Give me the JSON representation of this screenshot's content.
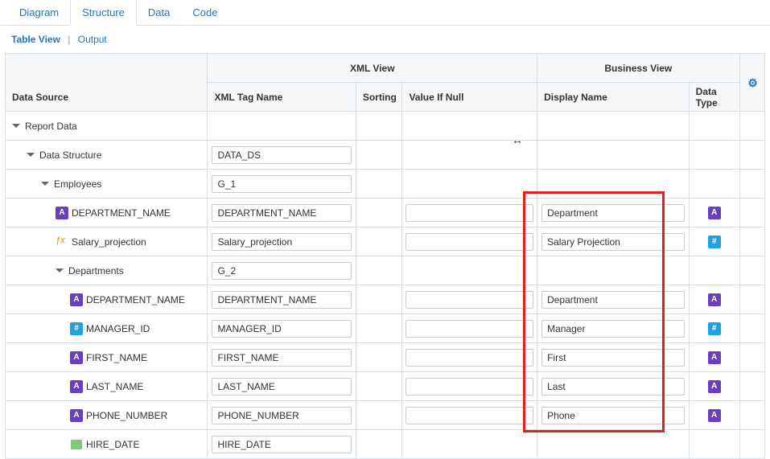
{
  "tabs": {
    "diagram": "Diagram",
    "structure": "Structure",
    "data": "Data",
    "code": "Code"
  },
  "subtabs": {
    "tableview": "Table View",
    "output": "Output"
  },
  "headers": {
    "xml_view": "XML View",
    "business_view": "Business View",
    "data_source": "Data Source",
    "xml_tag_name": "XML Tag Name",
    "sorting": "Sorting",
    "value_if_null": "Value If Null",
    "display_name": "Display Name",
    "data_type": "Data Type"
  },
  "rows": [
    {
      "indent": 1,
      "kind": "group",
      "label": "Report Data",
      "xml": "",
      "disp": "",
      "dtype": ""
    },
    {
      "indent": 2,
      "kind": "group",
      "label": "Data Structure",
      "xml": "DATA_DS",
      "disp": "",
      "dtype": ""
    },
    {
      "indent": 3,
      "kind": "group",
      "label": "Employees",
      "xml": "G_1",
      "disp": "",
      "dtype": ""
    },
    {
      "indent": 4,
      "kind": "field",
      "icon": "A",
      "label": "DEPARTMENT_NAME",
      "xml": "DEPARTMENT_NAME",
      "null": "",
      "disp": "Department",
      "dtype": "A"
    },
    {
      "indent": 4,
      "kind": "fx",
      "icon": "fx",
      "label": "Salary_projection",
      "xml": "Salary_projection",
      "null": "",
      "disp": "Salary Projection",
      "dtype": "H"
    },
    {
      "indent": 4,
      "kind": "group",
      "label": "Departments",
      "xml": "G_2",
      "disp": "",
      "dtype": ""
    },
    {
      "indent": 5,
      "kind": "field",
      "icon": "A",
      "label": "DEPARTMENT_NAME",
      "xml": "DEPARTMENT_NAME",
      "null": "",
      "disp": "Department",
      "dtype": "A"
    },
    {
      "indent": 5,
      "kind": "field",
      "icon": "H",
      "label": "MANAGER_ID",
      "xml": "MANAGER_ID",
      "null": "",
      "disp": "Manager",
      "dtype": "H"
    },
    {
      "indent": 5,
      "kind": "field",
      "icon": "A",
      "label": "FIRST_NAME",
      "xml": "FIRST_NAME",
      "null": "",
      "disp": "First",
      "dtype": "A"
    },
    {
      "indent": 5,
      "kind": "field",
      "icon": "A",
      "label": "LAST_NAME",
      "xml": "LAST_NAME",
      "null": "",
      "disp": "Last",
      "dtype": "A"
    },
    {
      "indent": 5,
      "kind": "field",
      "icon": "A",
      "label": "PHONE_NUMBER",
      "xml": "PHONE_NUMBER",
      "null": "",
      "disp": "Phone",
      "dtype": "A"
    },
    {
      "indent": 5,
      "kind": "date",
      "icon": "date",
      "label": "HIRE_DATE",
      "xml": "HIRE_DATE",
      "null": "",
      "disp": "",
      "dtype": ""
    }
  ]
}
